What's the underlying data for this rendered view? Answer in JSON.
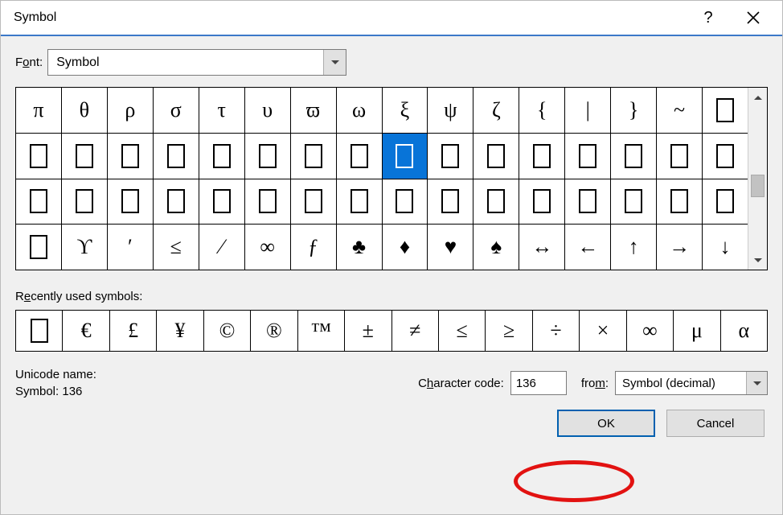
{
  "window": {
    "title": "Symbol"
  },
  "font": {
    "label_pre": "F",
    "label_u": "o",
    "label_post": "nt:",
    "value": "Symbol"
  },
  "grid": {
    "rows": [
      [
        "π",
        "θ",
        "ρ",
        "σ",
        "τ",
        "υ",
        "ϖ",
        "ω",
        "ξ",
        "ψ",
        "ζ",
        "{",
        "|",
        "}",
        "~",
        "□"
      ],
      [
        "□",
        "□",
        "□",
        "□",
        "□",
        "□",
        "□",
        "□",
        "□",
        "□",
        "□",
        "□",
        "□",
        "□",
        "□",
        "□"
      ],
      [
        "□",
        "□",
        "□",
        "□",
        "□",
        "□",
        "□",
        "□",
        "□",
        "□",
        "□",
        "□",
        "□",
        "□",
        "□",
        "□"
      ],
      [
        "□",
        "ϒ",
        "′",
        "≤",
        "⁄",
        "∞",
        "ƒ",
        "♣",
        "♦",
        "♥",
        "♠",
        "↔",
        "←",
        "↑",
        "→",
        "↓"
      ]
    ],
    "selected_row": 1,
    "selected_col": 8
  },
  "recent": {
    "label_pre": "R",
    "label_u": "e",
    "label_post": "cently used symbols:",
    "items": [
      "□",
      "€",
      "£",
      "¥",
      "©",
      "®",
      "™",
      "±",
      "≠",
      "≤",
      "≥",
      "÷",
      "×",
      "∞",
      "μ",
      "α"
    ]
  },
  "unicode": {
    "label": "Unicode name:",
    "value": "Symbol: 136"
  },
  "codefield": {
    "label_pre": "C",
    "label_u": "h",
    "label_post": "aracter code:",
    "value": "136"
  },
  "from": {
    "label_pre": "fro",
    "label_u": "m",
    "label_post": ":",
    "value": "Symbol (decimal)"
  },
  "buttons": {
    "ok": "OK",
    "cancel": "Cancel"
  }
}
